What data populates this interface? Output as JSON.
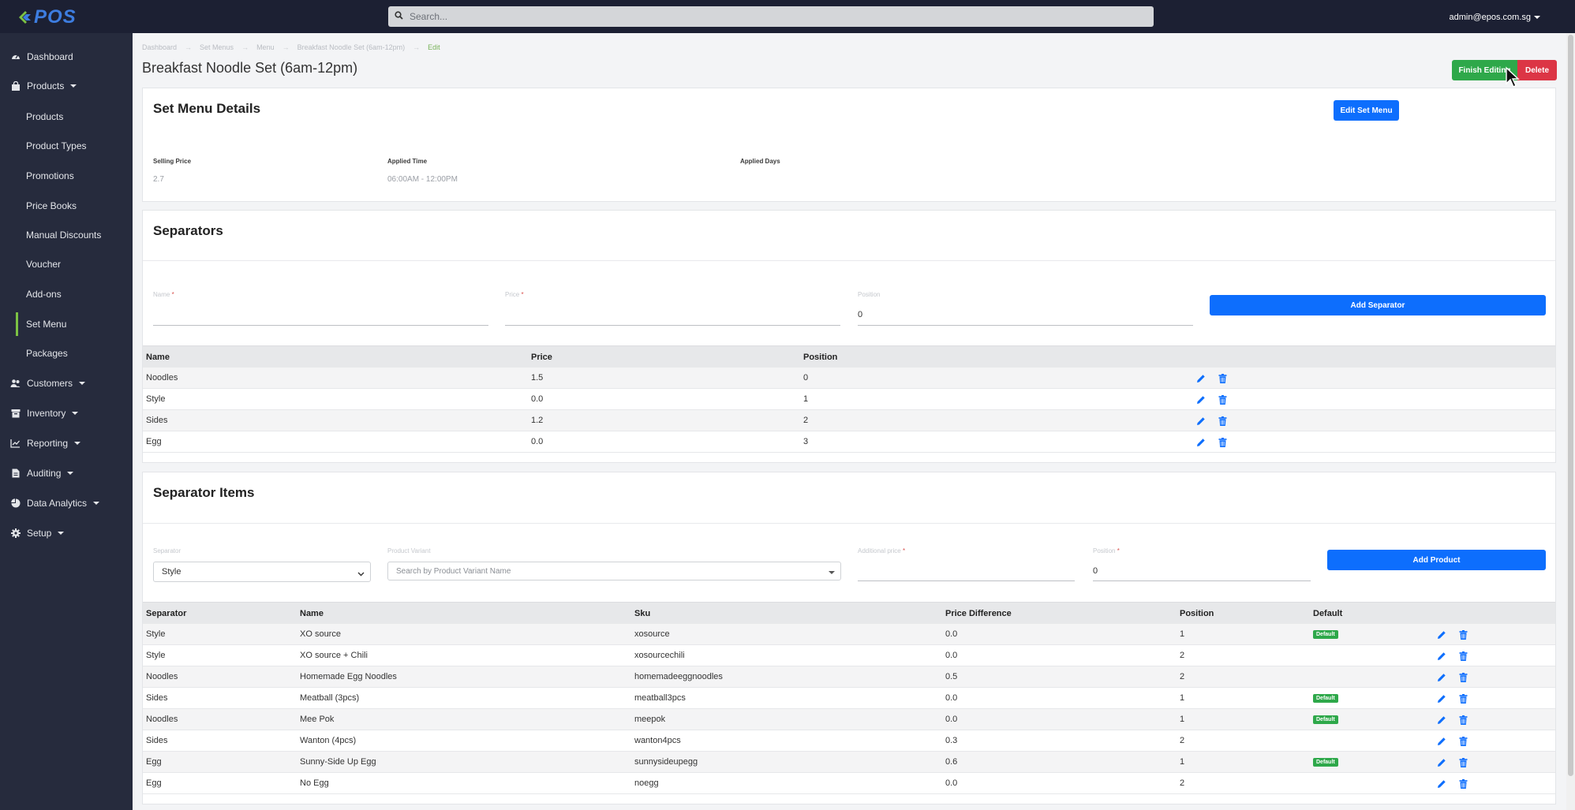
{
  "brand": {
    "logo_text": "POS",
    "accent": "#7cc244"
  },
  "search": {
    "placeholder": "Search..."
  },
  "user": {
    "email": "admin@epos.com.sg"
  },
  "sidebar": {
    "items": [
      {
        "label": "Dashboard",
        "icon": "dashboard-icon"
      },
      {
        "label": "Products",
        "icon": "bag-icon"
      },
      {
        "label": "Products"
      },
      {
        "label": "Product Types"
      },
      {
        "label": "Promotions"
      },
      {
        "label": "Price Books"
      },
      {
        "label": "Manual Discounts"
      },
      {
        "label": "Voucher"
      },
      {
        "label": "Add-ons"
      },
      {
        "label": "Set Menu"
      },
      {
        "label": "Packages"
      },
      {
        "label": "Customers",
        "icon": "users-icon"
      },
      {
        "label": "Inventory",
        "icon": "box-icon"
      },
      {
        "label": "Reporting",
        "icon": "chart-icon"
      },
      {
        "label": "Auditing",
        "icon": "file-icon"
      },
      {
        "label": "Data Analytics",
        "icon": "pie-icon"
      },
      {
        "label": "Setup",
        "icon": "gear-icon"
      }
    ]
  },
  "breadcrumb": [
    "Dashboard",
    "Set Menus",
    "Menu",
    "Breakfast Noodle Set (6am-12pm)",
    "Edit"
  ],
  "page": {
    "title": "Breakfast Noodle Set (6am-12pm)",
    "finish_label": "Finish Editing",
    "delete_label": "Delete"
  },
  "details": {
    "title": "Set Menu Details",
    "edit_label": "Edit Set Menu",
    "selling_price_label": "Selling Price",
    "selling_price": "2.7",
    "applied_time_label": "Applied Time",
    "applied_time": "06:00AM - 12:00PM",
    "applied_days_label": "Applied Days"
  },
  "separators": {
    "title": "Separators",
    "name_label": "Name",
    "price_label": "Price",
    "position_label": "Position",
    "position_value": "0",
    "add_label": "Add Separator",
    "headers": [
      "Name",
      "Price",
      "Position"
    ],
    "rows": [
      [
        "Noodles",
        "1.5",
        "0"
      ],
      [
        "Style",
        "0.0",
        "1"
      ],
      [
        "Sides",
        "1.2",
        "2"
      ],
      [
        "Egg",
        "0.0",
        "3"
      ]
    ]
  },
  "items": {
    "title": "Separator Items",
    "separator_label": "Separator",
    "separator_value": "Style",
    "variant_label": "Product Variant",
    "variant_placeholder": "Search by Product Variant Name",
    "additional_price_label": "Additional price",
    "position_label": "Position",
    "position_value": "0",
    "add_label": "Add Product",
    "headers": [
      "Separator",
      "Name",
      "Sku",
      "Price Difference",
      "Position",
      "Default"
    ],
    "rows": [
      [
        "Style",
        "XO source",
        "xosource",
        "0.0",
        "1",
        "Default"
      ],
      [
        "Style",
        "XO source + Chili",
        "xosourcechili",
        "0.0",
        "2",
        ""
      ],
      [
        "Noodles",
        "Homemade Egg Noodles",
        "homemadeeggnoodles",
        "0.5",
        "2",
        ""
      ],
      [
        "Sides",
        "Meatball (3pcs)",
        "meatball3pcs",
        "0.0",
        "1",
        "Default"
      ],
      [
        "Noodles",
        "Mee Pok",
        "meepok",
        "0.0",
        "1",
        "Default"
      ],
      [
        "Sides",
        "Wanton (4pcs)",
        "wanton4pcs",
        "0.3",
        "2",
        ""
      ],
      [
        "Egg",
        "Sunny-Side Up Egg",
        "sunnysideupegg",
        "0.6",
        "1",
        "Default"
      ],
      [
        "Egg",
        "No Egg",
        "noegg",
        "0.0",
        "2",
        ""
      ]
    ]
  }
}
